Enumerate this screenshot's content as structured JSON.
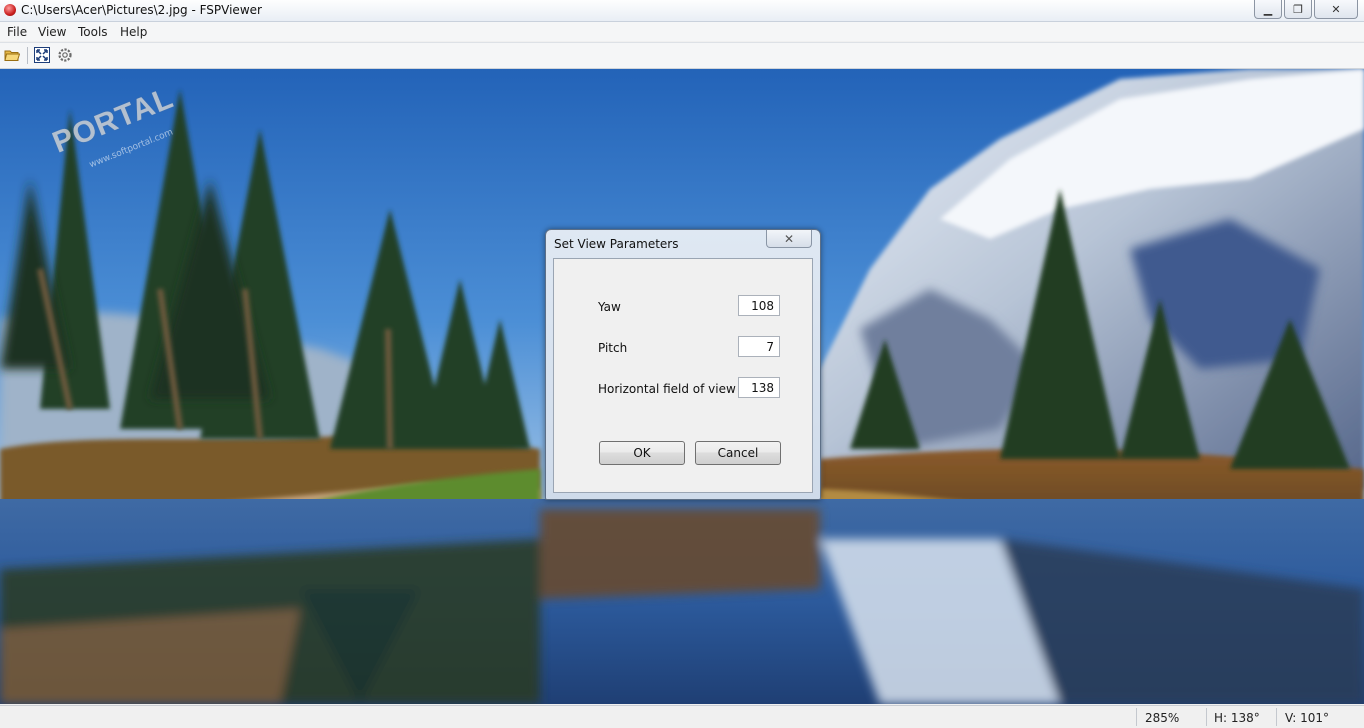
{
  "window": {
    "title": "C:\\Users\\Acer\\Pictures\\2.jpg - FSPViewer",
    "minimize_icon": "minimize-icon",
    "maximize_icon": "restore-icon",
    "close_icon": "close-icon"
  },
  "menu": {
    "items": [
      "File",
      "View",
      "Tools",
      "Help"
    ]
  },
  "toolbar": {
    "buttons": [
      "open-folder-icon",
      "fullscreen-icon",
      "settings-gear-icon"
    ]
  },
  "watermark": {
    "text": "PORTAL",
    "sub": "www.softportal.com"
  },
  "dialog": {
    "title": "Set View Parameters",
    "close_glyph": "✕",
    "fields": [
      {
        "label": "Yaw",
        "value": "108"
      },
      {
        "label": "Pitch",
        "value": "7"
      },
      {
        "label": "Horizontal field of view",
        "value": "138"
      }
    ],
    "ok_label": "OK",
    "cancel_label": "Cancel"
  },
  "status": {
    "zoom": "285%",
    "horizontal": "H: 138°",
    "vertical": "V: 101°"
  },
  "colors": {
    "sky": "#2f74c9",
    "mountain_snow": "#e8eef6",
    "water": "#2a5da6",
    "foliage": "#2f4a22"
  }
}
